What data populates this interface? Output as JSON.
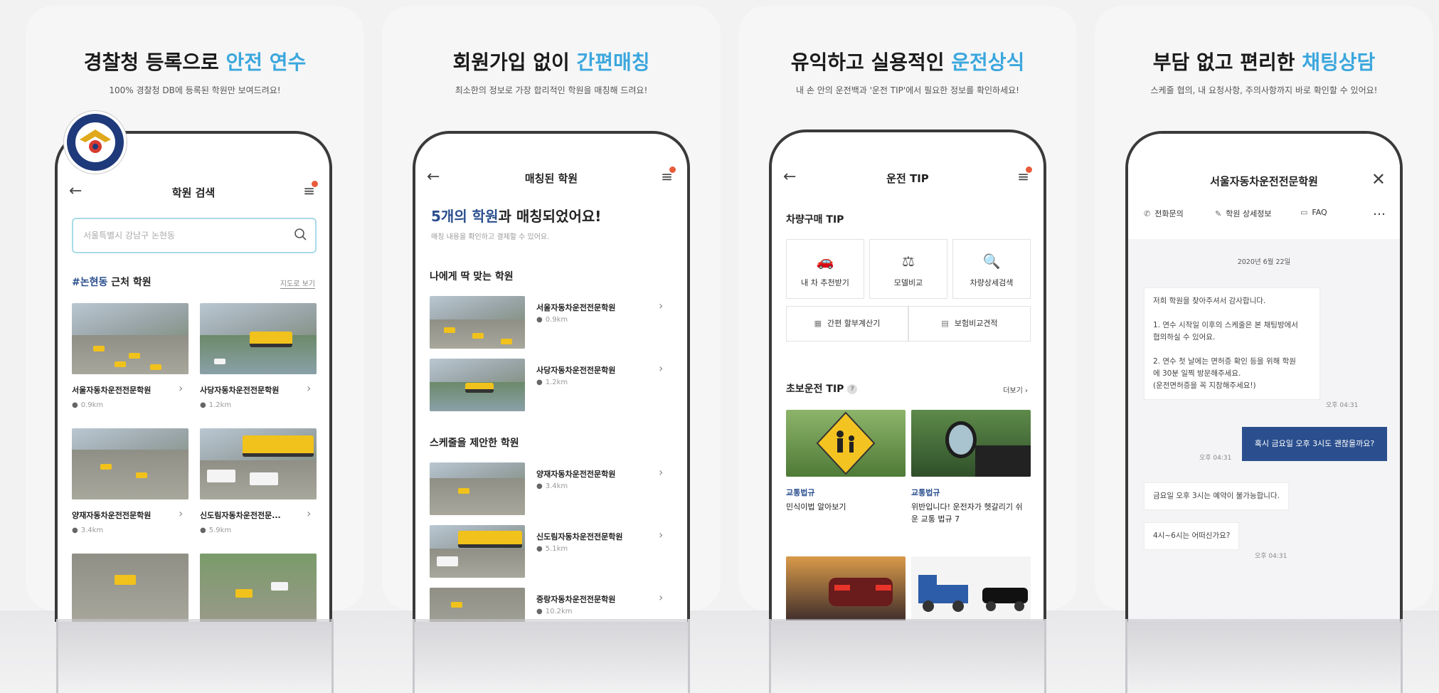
{
  "panel1": {
    "headline_plain": "경찰청 등록으로 ",
    "headline_accent": "안전 연수",
    "sub": "100% 경찰청 DB에 등록된 학원만 보여드려요!",
    "nav_title": "학원 검색",
    "search_placeholder": "서울특별시 강남구 논현동",
    "section_accent": "#논현동",
    "section_plain": " 근처 학원",
    "map_link": "지도로 보기",
    "items": [
      {
        "name": "서울자동차운전전문학원",
        "dist": "0.9km"
      },
      {
        "name": "사당자동차운전전문학원",
        "dist": "1.2km"
      },
      {
        "name": "양재자동차운전전문학원",
        "dist": "3.4km"
      },
      {
        "name": "신도림자동차운전전문...",
        "dist": "5.9km"
      }
    ]
  },
  "panel2": {
    "headline_plain": "회원가입 없이 ",
    "headline_accent": "간편매칭",
    "sub": "최소한의 정보로 가장 합리적인 학원을 매칭해 드려요!",
    "nav_title": "매칭된 학원",
    "match_accent": "5개의 학원",
    "match_plain": "과 매칭되었어요!",
    "match_sub": "매칭 내용을 확인하고 결제할 수 있어요.",
    "section1": "나에게 딱 맞는 학원",
    "section2": "스케줄을 제안한 학원",
    "items1": [
      {
        "name": "서울자동차운전전문학원",
        "dist": "0.9km"
      },
      {
        "name": "사당자동차운전전문학원",
        "dist": "1.2km"
      }
    ],
    "items2": [
      {
        "name": "양재자동차운전전문학원",
        "dist": "3.4km"
      },
      {
        "name": "신도림자동차운전전문학원",
        "dist": "5.1km"
      },
      {
        "name": "중랑자동차운전전문학원",
        "dist": "10.2km"
      }
    ]
  },
  "panel3": {
    "headline_plain": "유익하고 실용적인 ",
    "headline_accent": "운전상식",
    "sub": "내 손 안의 운전백과 '운전 TIP'에서 필요한 정보를 확인하세요!",
    "nav_title": "운전 TIP",
    "section1": "차량구매 TIP",
    "tiles": [
      "내 차 추천받기",
      "모델비교",
      "차량상세검색"
    ],
    "wide_tiles": [
      "간편 할부계산기",
      "보험비교견적"
    ],
    "section2": "초보운전 TIP",
    "more": "더보기",
    "articles": [
      {
        "category": "교통법규",
        "title": "민식이법 알아보기"
      },
      {
        "category": "교통법규",
        "title": "위반입니다! 운전자가 헷갈리기 쉬운 교통 법규 7"
      }
    ]
  },
  "panel4": {
    "headline_plain": "부담 없고 편리한 ",
    "headline_accent": "채팅상담",
    "sub": "스케줄 협의, 내 요청사항, 주의사항까지 바로 확인할 수 있어요!",
    "nav_title": "서울자동차운전전문학원",
    "actions": [
      "전화문의",
      "학원 상세정보",
      "FAQ"
    ],
    "date": "2020년 6월 22일",
    "msg1": "저희 학원을 찾아주셔서 감사합니다.\n\n1. 연수 시작일 이후의 스케줄은 본 채팅방에서\n   협의하실 수 있어요.\n\n2. 연수 첫 날에는 면허증 확인 등을 위해 학원\n   에 30분 일찍 방문해주세요.\n   (운전면허증을 꼭 지참해주세요!)",
    "msg2": "혹시 금요일 오후 3시도 괜찮을까요?",
    "msg3": "금요일 오후 3시는 예약이 불가능합니다.",
    "msg4": "4시~6시는 어떠신가요?",
    "time": "오후 04:31"
  },
  "colors": {
    "accent": "#3ba7dd",
    "brand_navy": "#2b4f8e",
    "alert_dot": "#e85b3a"
  }
}
